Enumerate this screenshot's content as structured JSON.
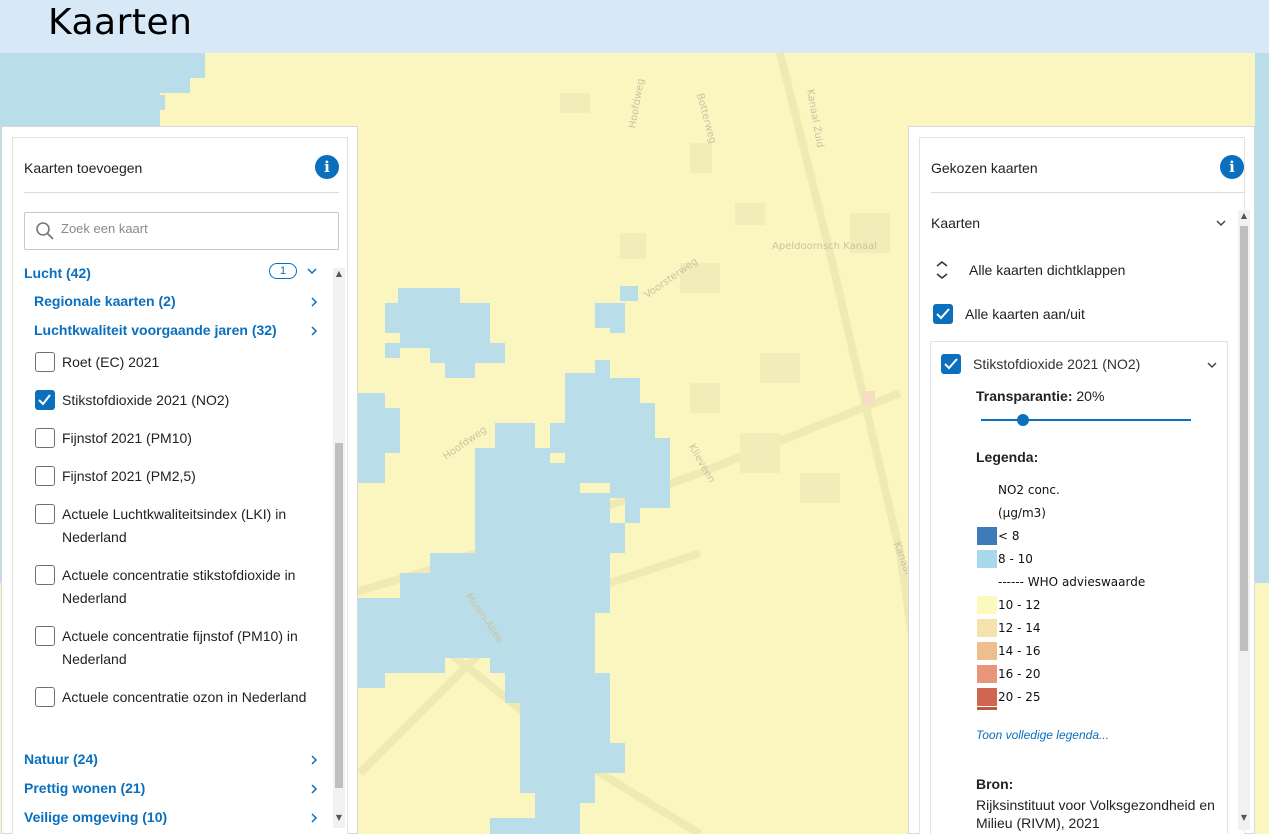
{
  "header": {
    "title": "Kaarten"
  },
  "map": {
    "water_color": "#b9dde9",
    "land_color": "#fbf6c0",
    "street_labels": [
      "Hoofdweg",
      "Botterweg",
      "Kanaal Zuid",
      "Voorsterweg",
      "Apeldoornsch Kanaal",
      "Hoofdweg",
      "Klieveen",
      "Molen-Allee",
      "Kanaal"
    ]
  },
  "left_panel": {
    "title": "Kaarten toevoegen",
    "info_icon": "info-icon",
    "search_placeholder": "Zoek een kaart",
    "category_top": {
      "label": "Lucht (42)",
      "badge": "1"
    },
    "subcategories": [
      {
        "label": "Regionale kaarten (2)"
      },
      {
        "label": "Luchtkwaliteit voorgaande jaren (32)"
      }
    ],
    "items": [
      {
        "label": "Roet (EC) 2021",
        "checked": false
      },
      {
        "label": "Stikstofdioxide 2021 (NO2)",
        "checked": true
      },
      {
        "label": "Fijnstof 2021 (PM10)",
        "checked": false
      },
      {
        "label": "Fijnstof 2021 (PM2,5)",
        "checked": false
      },
      {
        "label": "Actuele Luchtkwaliteitsindex (LKI) in Nederland",
        "checked": false
      },
      {
        "label": "Actuele concentratie stikstofdioxide in Nederland",
        "checked": false
      },
      {
        "label": "Actuele concentratie fijnstof (PM10) in Nederland",
        "checked": false
      },
      {
        "label": "Actuele concentratie ozon in Nederland",
        "checked": false
      }
    ],
    "categories_bottom": [
      {
        "label": "Natuur (24)"
      },
      {
        "label": "Prettig wonen (21)"
      },
      {
        "label": "Veilige omgeving (10)"
      }
    ]
  },
  "right_panel": {
    "title": "Gekozen kaarten",
    "section_label": "Kaarten",
    "collapse_all": "Alle kaarten dichtklappen",
    "toggle_all": "Alle kaarten aan/uit",
    "layer": {
      "name": "Stikstofdioxide 2021 (NO2)",
      "transparency_label": "Transparantie:",
      "transparency_value": "20%",
      "transparency_level": 0.2,
      "legend_title": "Legenda:",
      "legend_header_1": "NO2 conc.",
      "legend_header_2": "(µg/m3)",
      "legend": [
        {
          "label": "< 8",
          "color": "#3f7bb8"
        },
        {
          "label": "8 - 10",
          "color": "#a9d8ec"
        },
        {
          "label": "------ WHO advieswaarde",
          "color": ""
        },
        {
          "label": "10 - 12",
          "color": "#fcf9be"
        },
        {
          "label": "12 - 14",
          "color": "#f6e2ae"
        },
        {
          "label": "14 - 16",
          "color": "#efbe8e"
        },
        {
          "label": "16 - 20",
          "color": "#e8977a"
        },
        {
          "label": "20 - 25",
          "color": "#cf6652"
        }
      ],
      "full_legend_link": "Toon volledige legenda...",
      "source_label": "Bron:",
      "source_text": "Rijksinstituut voor Volksgezondheid en Milieu (RIVM), 2021"
    }
  }
}
